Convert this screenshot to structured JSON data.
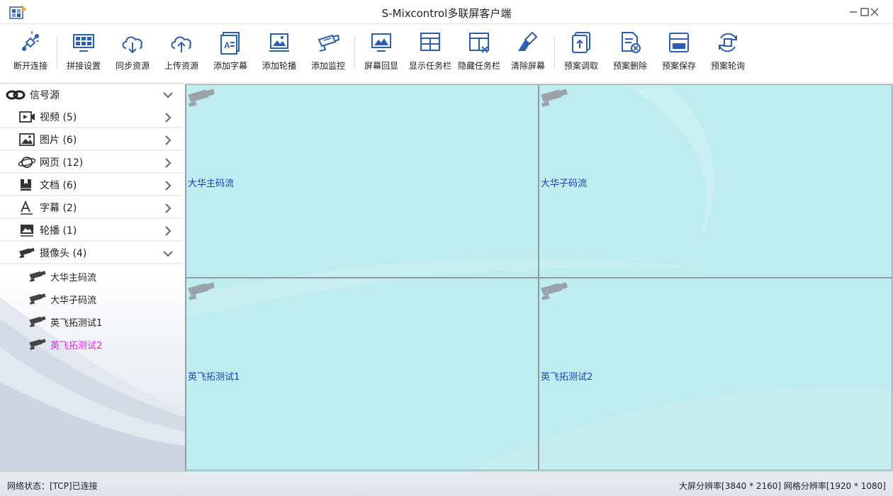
{
  "window": {
    "title": "S-Mixcontrol多联屏客户端"
  },
  "toolbar": [
    {
      "label": "断开连接",
      "icon": "disconnect-icon"
    },
    {
      "label": "拼接设置",
      "icon": "splice-settings-icon"
    },
    {
      "label": "同步资源",
      "icon": "cloud-download-icon"
    },
    {
      "label": "上传资源",
      "icon": "cloud-upload-icon"
    },
    {
      "label": "添加字幕",
      "icon": "add-subtitle-icon"
    },
    {
      "label": "添加轮播",
      "icon": "add-carousel-icon"
    },
    {
      "label": "添加监控",
      "icon": "add-monitor-icon"
    },
    {
      "label": "屏幕回显",
      "icon": "screen-echo-icon"
    },
    {
      "label": "显示任务栏",
      "icon": "show-taskbar-icon"
    },
    {
      "label": "隐藏任务栏",
      "icon": "hide-taskbar-icon"
    },
    {
      "label": "清除屏幕",
      "icon": "clear-screen-icon"
    },
    {
      "label": "预案调取",
      "icon": "plan-load-icon"
    },
    {
      "label": "预案删除",
      "icon": "plan-delete-icon"
    },
    {
      "label": "预案保存",
      "icon": "plan-save-icon"
    },
    {
      "label": "预案轮询",
      "icon": "plan-poll-icon"
    }
  ],
  "sidebar": {
    "header": "信号源",
    "categories": [
      {
        "label": "视频 (5)",
        "icon": "video-icon"
      },
      {
        "label": "图片 (6)",
        "icon": "image-icon"
      },
      {
        "label": "网页 (12)",
        "icon": "globe-icon"
      },
      {
        "label": "文档 (6)",
        "icon": "document-icon"
      },
      {
        "label": "字幕 (2)",
        "icon": "font-icon"
      },
      {
        "label": "轮播 (1)",
        "icon": "carousel-icon"
      },
      {
        "label": "摄像头 (4)",
        "icon": "camera-icon"
      }
    ],
    "cameras": [
      {
        "label": "大华主码流"
      },
      {
        "label": "大华子码流"
      },
      {
        "label": "英飞拓测试1"
      },
      {
        "label": "英飞拓测试2"
      }
    ]
  },
  "screen": {
    "cells": [
      {
        "label": "大华主码流"
      },
      {
        "label": "大华子码流"
      },
      {
        "label": "英飞拓测试1"
      },
      {
        "label": "英飞拓测试2"
      }
    ]
  },
  "status": {
    "network": "网络状态：[TCP]已连接",
    "resolution": "大屏分辨率[3840 * 2160] 网格分辨率[1920 * 1080]"
  },
  "colors": {
    "active_item": "#e020e0",
    "cell_label": "#1d3fb4",
    "screen_bg": "#b9e7eb"
  }
}
